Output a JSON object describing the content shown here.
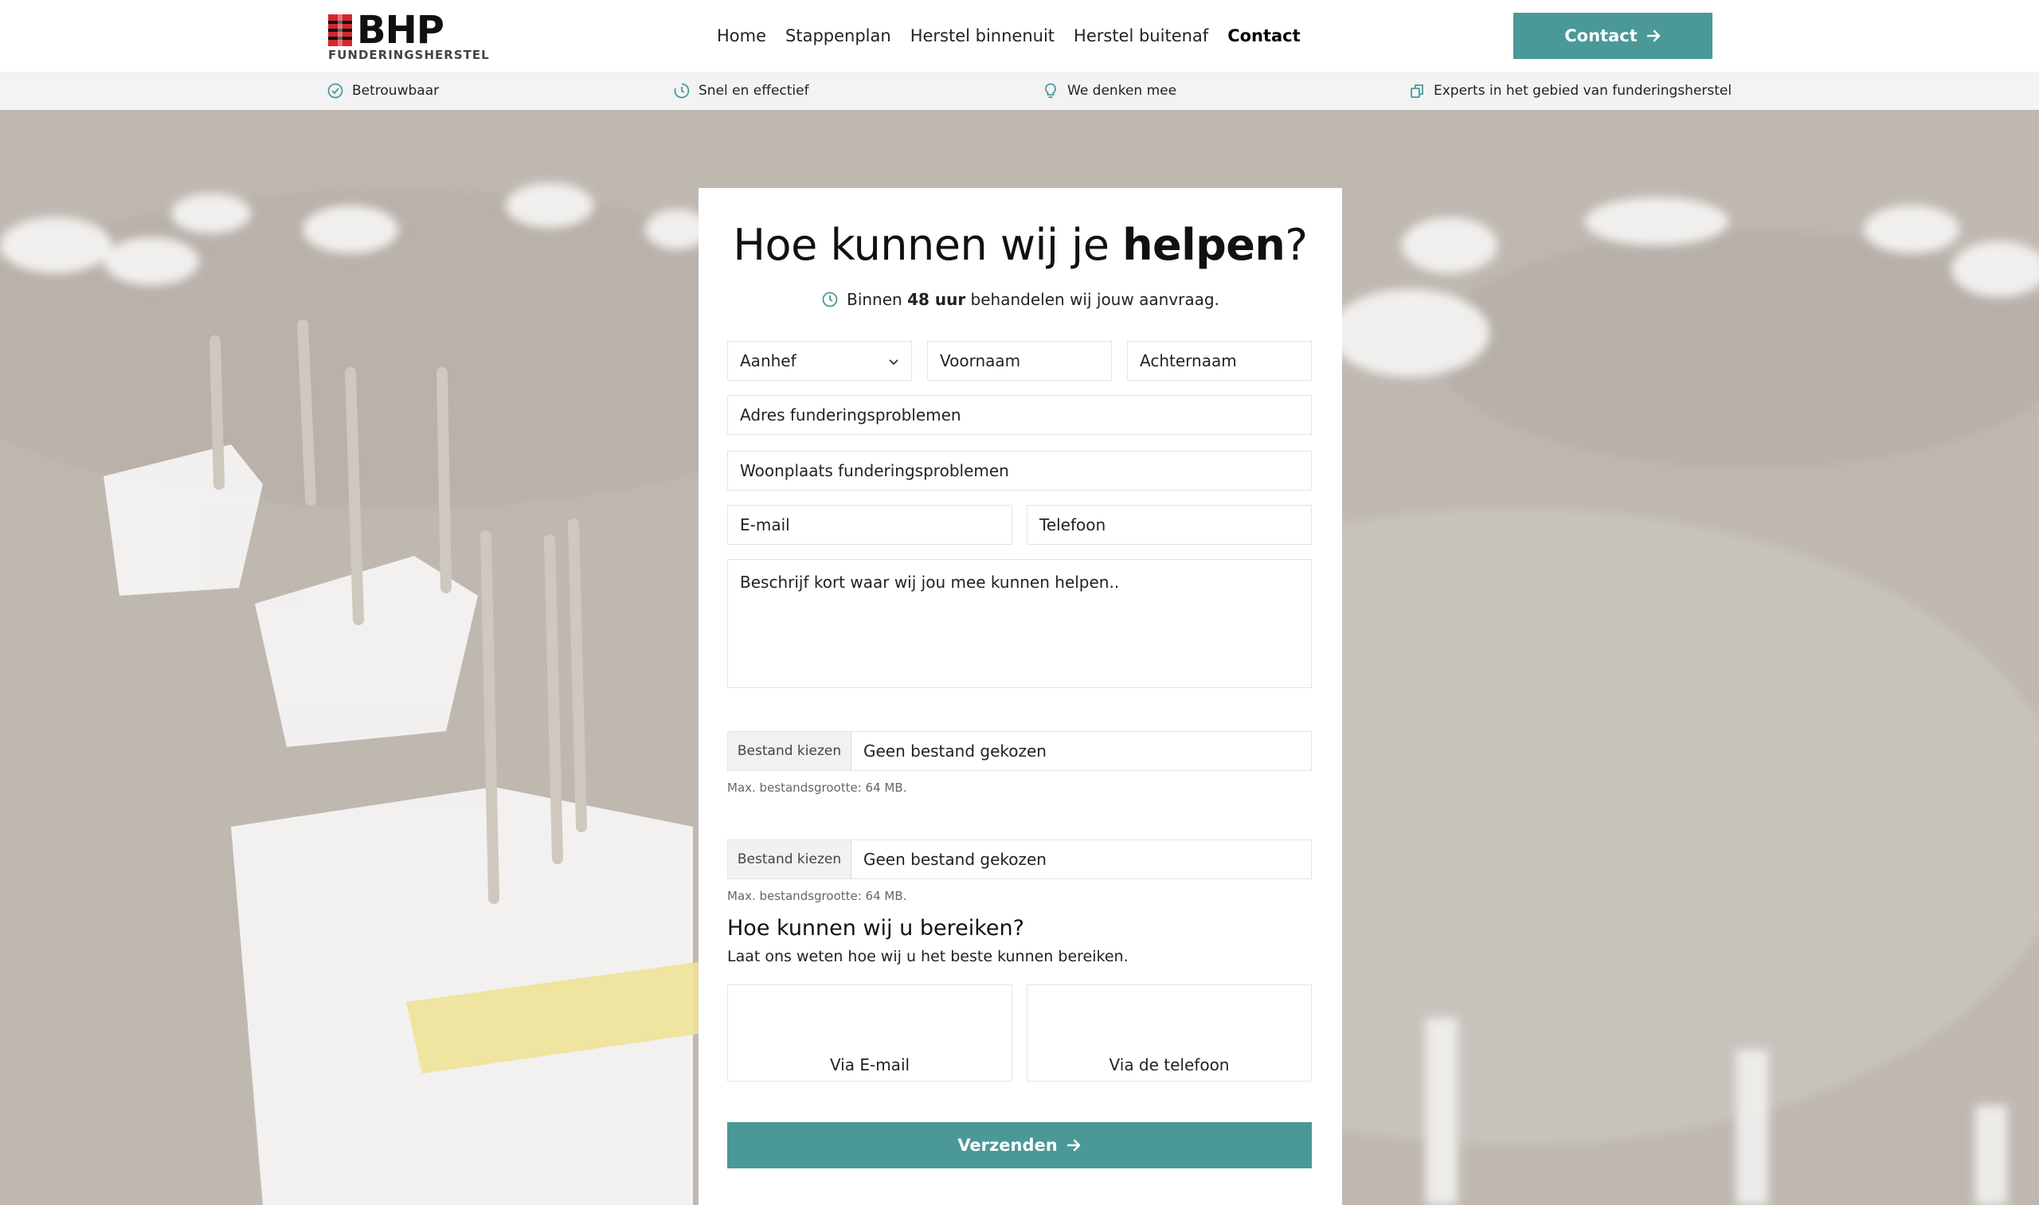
{
  "brand": {
    "name": "BHP",
    "tagline": "FUNDERINGSHERSTEL",
    "accent_color": "#4a9898"
  },
  "nav": {
    "items": [
      {
        "label": "Home"
      },
      {
        "label": "Stappenplan"
      },
      {
        "label": "Herstel binnenuit"
      },
      {
        "label": "Herstel buitenaf"
      },
      {
        "label": "Contact",
        "active": true
      }
    ],
    "cta_label": "Contact"
  },
  "usps": [
    {
      "label": "Betrouwbaar",
      "icon": "check-circle-icon"
    },
    {
      "label": "Snel en effectief",
      "icon": "timer-icon"
    },
    {
      "label": "We denken mee",
      "icon": "lightbulb-icon"
    },
    {
      "label": "Experts in het gebied van funderingsherstel",
      "icon": "expert-icon"
    }
  ],
  "form": {
    "title_pre": "Hoe kunnen wij je ",
    "title_bold": "helpen",
    "title_post": "?",
    "subtitle_pre": "Binnen ",
    "subtitle_bold": "48 uur",
    "subtitle_post": " behandelen wij jouw aanvraag.",
    "salutation_label": "Aanhef",
    "first_name_placeholder": "Voornaam",
    "last_name_placeholder": "Achternaam",
    "address_placeholder": "Adres funderingsproblemen",
    "city_placeholder": "Woonplaats funderingsproblemen",
    "email_placeholder": "E-mail",
    "phone_placeholder": "Telefoon",
    "message_placeholder": "Beschrijf kort waar wij jou mee kunnen helpen..",
    "file_button_label": "Bestand kiezen",
    "file_none_label": "Geen bestand gekozen",
    "file_hint": "Max. bestandsgrootte: 64 MB.",
    "reach_title": "Hoe kunnen wij u bereiken?",
    "reach_subtitle": "Laat ons weten hoe wij u het beste kunnen bereiken.",
    "option_email": "Via E-mail",
    "option_phone": "Via de telefoon",
    "submit_label": "Verzenden"
  }
}
